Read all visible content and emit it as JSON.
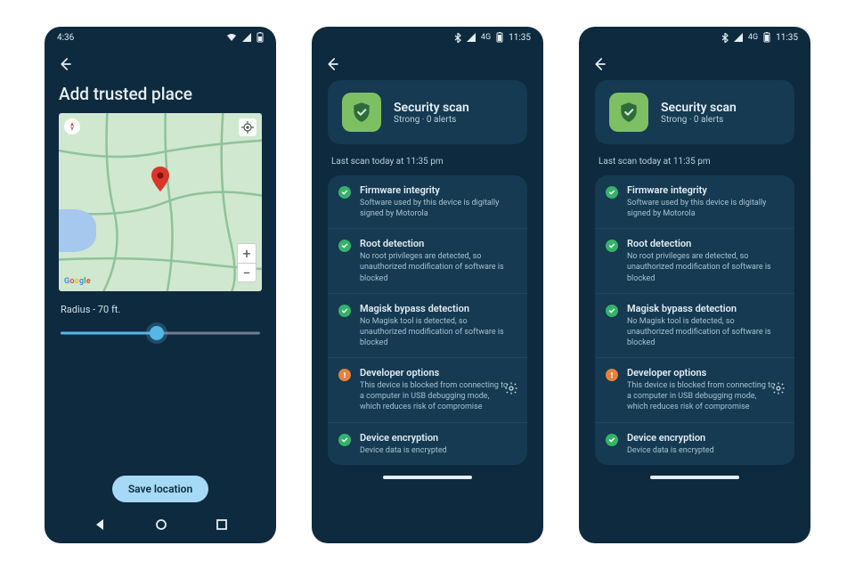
{
  "phone_a": {
    "status_time": "4:36",
    "title": "Add trusted place",
    "radius_label": "Radius - 70 ft.",
    "save_label": "Save location",
    "zoom_plus": "+",
    "zoom_minus": "−",
    "slider_pct": 48
  },
  "scan": {
    "status_time": "11:35",
    "card_title": "Security scan",
    "card_sub": "Strong · 0 alerts",
    "last_scan": "Last scan today at 11:35 pm",
    "checks": [
      {
        "status": "ok",
        "title": "Firmware integrity",
        "desc": "Software used by this device is digitally signed by Motorola"
      },
      {
        "status": "ok",
        "title": "Root detection",
        "desc": "No root privileges are detected, so unauthorized modification of software is blocked"
      },
      {
        "status": "ok",
        "title": "Magisk bypass detection",
        "desc": "No Magisk tool is detected, so unauthorized modification of software is blocked"
      },
      {
        "status": "warn",
        "title": "Developer options",
        "desc": "This device is blocked from connecting to a computer in USB debugging mode, which reduces risk of compromise",
        "gear": true
      },
      {
        "status": "ok",
        "title": "Device encryption",
        "desc": "Device data is encrypted"
      }
    ]
  }
}
